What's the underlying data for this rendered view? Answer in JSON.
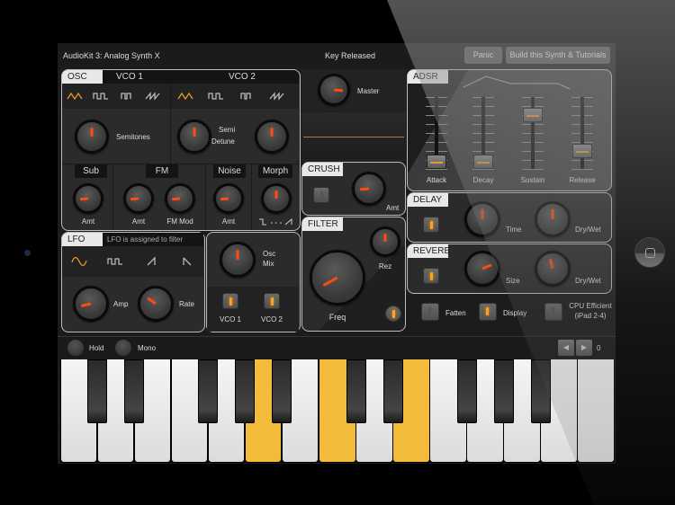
{
  "app": {
    "title": "AudioKit 3: Analog Synth X",
    "status": "Key Released",
    "panic_label": "Panic",
    "tutorials_label": "Build this Synth & Tutorials"
  },
  "osc": {
    "tag": "OSC",
    "vco1_label": "VCO 1",
    "vco2_label": "VCO 2",
    "waveforms": [
      "triangle",
      "square",
      "pulse",
      "sawtooth"
    ],
    "vco1_selected_waveform": "triangle",
    "vco2_selected_waveform": "triangle",
    "semitones_label": "Semitones",
    "semi_label": "Semi",
    "detune_label": "Detune",
    "semitones_value": 0.5,
    "semi_value": 0.5,
    "detune_value": 0.5
  },
  "sub": {
    "header": "Sub",
    "amt_label": "Amt",
    "amt_value": 0.15
  },
  "fm": {
    "header": "FM",
    "amt_label": "Amt",
    "mod_label": "FM Mod",
    "amt_value": 0.15,
    "mod_value": 0.15
  },
  "noise": {
    "header": "Noise",
    "amt_label": "Amt",
    "amt_value": 0.15
  },
  "morph": {
    "header": "Morph",
    "value": 0.5,
    "range_icon": "square-to-saw"
  },
  "lfo": {
    "tag": "LFO",
    "info": "LFO is assigned to filter",
    "waveforms": [
      "sine",
      "square",
      "saw-up",
      "saw-down"
    ],
    "selected_waveform": "sine",
    "amp_label": "Amp",
    "rate_label": "Rate",
    "amp_value": 0.12,
    "rate_value": 0.3
  },
  "osc_mix": {
    "label_line1": "Osc",
    "label_line2": "Mix",
    "value": 0.5,
    "vco1_label": "VCO 1",
    "vco2_label": "VCO 2",
    "vco1_on": true,
    "vco2_on": true
  },
  "master": {
    "label": "Master",
    "value": 0.85
  },
  "crush": {
    "tag": "CRUSH",
    "amt_label": "Amt",
    "amt_value": 0.15,
    "enabled": false
  },
  "filter": {
    "tag": "FILTER",
    "freq_label": "Freq",
    "rez_label": "Rez",
    "freq_value": 0.06,
    "rez_value": 0.5,
    "enabled": true
  },
  "adsr": {
    "tag": "ADSR",
    "sliders": [
      {
        "label": "Attack",
        "value": 0.1
      },
      {
        "label": "Decay",
        "value": 0.1
      },
      {
        "label": "Sustain",
        "value": 0.75
      },
      {
        "label": "Release",
        "value": 0.25
      }
    ]
  },
  "delay": {
    "tag": "DELAY",
    "time_label": "Time",
    "drywet_label": "Dry/Wet",
    "time_value": 0.5,
    "drywet_value": 0.5,
    "enabled": true
  },
  "reverb": {
    "tag": "REVERB",
    "size_label": "Size",
    "drywet_label": "Dry/Wet",
    "size_value": 0.75,
    "drywet_value": 0.45,
    "enabled": true
  },
  "options": [
    {
      "label": "Fatten",
      "on": false
    },
    {
      "label": "Display",
      "on": true
    },
    {
      "label": "CPU Efficient",
      "label2": "(iPad 2-4)",
      "on": false
    }
  ],
  "controls": {
    "hold_label": "Hold",
    "mono_label": "Mono",
    "octave_value": "0",
    "prev_icon": "◀",
    "next_icon": "▶"
  },
  "keyboard": {
    "white_keys": 15,
    "black_key_after_white": [
      0,
      1,
      3,
      4,
      5,
      7,
      8,
      10,
      11,
      12
    ],
    "pressed_white_keys": [
      5,
      7,
      9
    ]
  },
  "colors": {
    "accent": "#ff4a10",
    "key_pressed": "#f2bc3a",
    "led_on": "#ffa020",
    "wave_selected": "#e89a30"
  }
}
